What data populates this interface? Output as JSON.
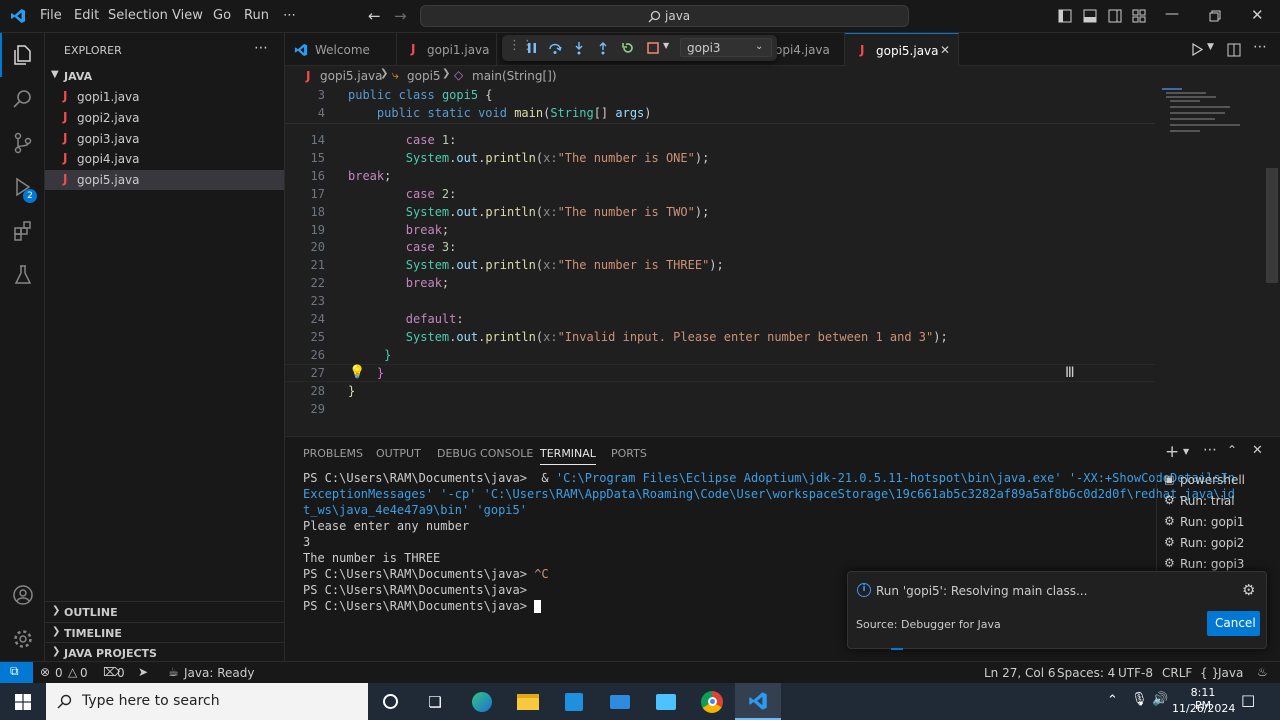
{
  "menu": [
    "File",
    "Edit",
    "Selection",
    "View",
    "Go",
    "Run",
    "⋯"
  ],
  "search": {
    "text": "java"
  },
  "explorer": {
    "title": "EXPLORER",
    "more": "⋯",
    "folder": "JAVA",
    "files": [
      "gopi1.java",
      "gopi2.java",
      "gopi3.java",
      "gopi4.java",
      "gopi5.java"
    ],
    "file_icon": "J",
    "sections": [
      "OUTLINE",
      "TIMELINE",
      "JAVA PROJECTS"
    ]
  },
  "activity_badge": "2",
  "tabs": [
    {
      "label": "Welcome"
    },
    {
      "label": "gopi1.java"
    },
    {
      "label": "opi4.java"
    },
    {
      "label": "gopi5.java",
      "close": "✕"
    }
  ],
  "debug_toolbar": {
    "config": "gopi3"
  },
  "breadcrumb": {
    "file": "gopi5.java",
    "class": "gopi5",
    "method": "main(String[])"
  },
  "editor": {
    "sticky": [
      {
        "ln": "3",
        "parts": [
          [
            "kw",
            "public "
          ],
          [
            "kw",
            "class "
          ],
          [
            "ty",
            "gopi5 "
          ],
          [
            "",
            "{"
          ]
        ]
      },
      {
        "ln": "4",
        "parts": [
          [
            "",
            "    "
          ],
          [
            "kw",
            "public "
          ],
          [
            "kw",
            "static "
          ],
          [
            "kw",
            "void "
          ],
          [
            "fn",
            "main"
          ],
          [
            "",
            "("
          ],
          [
            "ty",
            "String"
          ],
          [
            "",
            "[] "
          ],
          [
            "var",
            "args"
          ],
          [
            "",
            ")"
          ]
        ]
      }
    ],
    "lines": [
      {
        "ln": "14",
        "parts": [
          [
            "",
            "        "
          ],
          [
            "ctl",
            "case "
          ],
          [
            "num",
            "1"
          ],
          [
            "",
            ":"
          ]
        ]
      },
      {
        "ln": "15",
        "parts": [
          [
            "",
            "        "
          ],
          [
            "ty",
            "System"
          ],
          [
            "",
            "."
          ],
          [
            "var",
            "out"
          ],
          [
            "",
            "."
          ],
          [
            "fn",
            "println"
          ],
          [
            "",
            "("
          ],
          [
            "hint",
            "x:"
          ],
          [
            "str",
            "\"The number is ONE\""
          ],
          [
            "",
            ");"
          ]
        ]
      },
      {
        "ln": "16",
        "parts": [
          [
            "ctl",
            "break"
          ],
          [
            "",
            ";"
          ]
        ]
      },
      {
        "ln": "17",
        "parts": [
          [
            "",
            "        "
          ],
          [
            "ctl",
            "case "
          ],
          [
            "num",
            "2"
          ],
          [
            "",
            ":"
          ]
        ]
      },
      {
        "ln": "18",
        "parts": [
          [
            "",
            "        "
          ],
          [
            "ty",
            "System"
          ],
          [
            "",
            "."
          ],
          [
            "var",
            "out"
          ],
          [
            "",
            "."
          ],
          [
            "fn",
            "println"
          ],
          [
            "",
            "("
          ],
          [
            "hint",
            "x:"
          ],
          [
            "str",
            "\"The number is TWO\""
          ],
          [
            "",
            ");"
          ]
        ]
      },
      {
        "ln": "19",
        "parts": [
          [
            "",
            "        "
          ],
          [
            "ctl",
            "break"
          ],
          [
            "",
            ";"
          ]
        ]
      },
      {
        "ln": "20",
        "parts": [
          [
            "",
            "        "
          ],
          [
            "ctl",
            "case "
          ],
          [
            "num",
            "3"
          ],
          [
            "",
            ":"
          ]
        ]
      },
      {
        "ln": "21",
        "parts": [
          [
            "",
            "        "
          ],
          [
            "ty",
            "System"
          ],
          [
            "",
            "."
          ],
          [
            "var",
            "out"
          ],
          [
            "",
            "."
          ],
          [
            "fn",
            "println"
          ],
          [
            "",
            "("
          ],
          [
            "hint",
            "x:"
          ],
          [
            "str",
            "\"The number is THREE\""
          ],
          [
            "",
            ");"
          ]
        ]
      },
      {
        "ln": "22",
        "parts": [
          [
            "",
            "        "
          ],
          [
            "ctl",
            "break"
          ],
          [
            "",
            ";"
          ]
        ]
      },
      {
        "ln": "23",
        "parts": [
          [
            "",
            ""
          ]
        ]
      },
      {
        "ln": "24",
        "parts": [
          [
            "",
            "        "
          ],
          [
            "ctl",
            "default"
          ],
          [
            "",
            ":"
          ]
        ]
      },
      {
        "ln": "25",
        "parts": [
          [
            "",
            "        "
          ],
          [
            "ty",
            "System"
          ],
          [
            "",
            "."
          ],
          [
            "var",
            "out"
          ],
          [
            "",
            "."
          ],
          [
            "fn",
            "println"
          ],
          [
            "",
            "("
          ],
          [
            "hint",
            "x:"
          ],
          [
            "str",
            "\"Invalid input. Please enter number between 1 and 3\""
          ],
          [
            "",
            ");"
          ]
        ]
      },
      {
        "ln": "26",
        "parts": [
          [
            "",
            "     "
          ],
          [
            "ty",
            "}"
          ]
        ]
      },
      {
        "ln": "27",
        "parts": [
          [
            "",
            "    "
          ],
          [
            "brace",
            "}"
          ]
        ]
      },
      {
        "ln": "28",
        "parts": [
          [
            "fn",
            "}"
          ]
        ]
      },
      {
        "ln": "29",
        "parts": [
          [
            "",
            ""
          ]
        ]
      }
    ]
  },
  "panel": {
    "tabs": [
      "PROBLEMS",
      "OUTPUT",
      "DEBUG CONSOLE",
      "TERMINAL",
      "PORTS"
    ],
    "active_tab": "TERMINAL",
    "terminal": [
      {
        "prompt": "PS C:\\Users\\RAM\\Documents\\java> ",
        "cmd": " & ",
        "rest": "'C:\\Program Files\\Eclipse Adoptium\\jdk-21.0.5.11-hotspot\\bin\\java.exe' '-XX:+ShowCodeDetailsIn"
      },
      {
        "prompt": "",
        "cmd": "",
        "rest": "ExceptionMessages' '-cp' 'C:\\Users\\RAM\\AppData\\Roaming\\Code\\User\\workspaceStorage\\19c661ab5c3282af89a5af8b6c0d2d0f\\redhat.java\\jd"
      },
      {
        "prompt": "",
        "cmd": "",
        "rest": "t_ws\\java_4e4e47a9\\bin' 'gopi5'"
      },
      {
        "prompt": "Please enter any number",
        "cmd": "",
        "rest": ""
      },
      {
        "prompt": "3",
        "cmd": "",
        "rest": ""
      },
      {
        "prompt": "The number is THREE",
        "cmd": "",
        "rest": ""
      },
      {
        "prompt": "PS C:\\Users\\RAM\\Documents\\java> ",
        "cmd": "",
        "rest": "^C"
      },
      {
        "prompt": "PS C:\\Users\\RAM\\Documents\\java> ",
        "cmd": "",
        "rest": ""
      },
      {
        "prompt": "PS C:\\Users\\RAM\\Documents\\java> ",
        "cmd": "",
        "rest": ""
      }
    ],
    "terminal_list": [
      "powershell",
      "Run: trial",
      "Run: gopi1",
      "Run: gopi2",
      "Run: gopi3"
    ]
  },
  "notification": {
    "message": "Run 'gopi5': Resolving main class...",
    "source": "Source: Debugger for Java",
    "button": "Cancel"
  },
  "status": {
    "errors": "0",
    "warnings": "0",
    "ports": "0",
    "java": "Java: Ready",
    "position": "Ln 27, Col 6",
    "spaces": "Spaces: 4",
    "encoding": "UTF-8",
    "eol": "CRLF",
    "lang": "Java",
    "lang_braces": "{ }"
  },
  "taskbar": {
    "search_placeholder": "Type here to search",
    "time": "8:11 PM",
    "date": "11/26/2024"
  },
  "colors": {
    "accent": "#0078d4",
    "statusbar_remote": "#0078d4"
  }
}
